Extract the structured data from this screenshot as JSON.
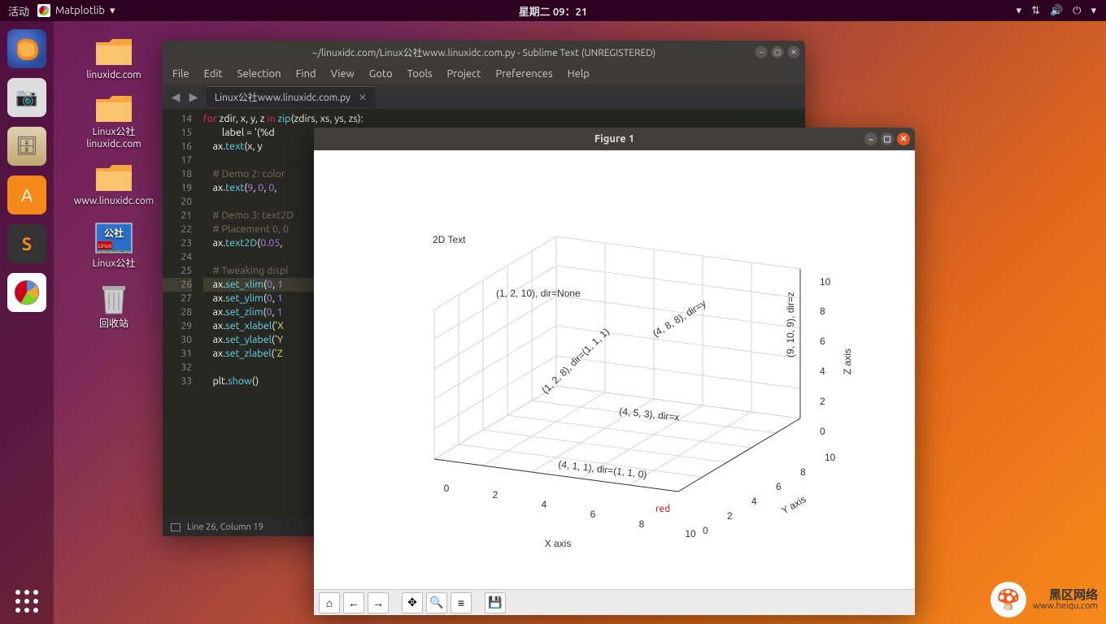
{
  "top_panel": {
    "activities": "活动",
    "app_label": "Matplotlib",
    "datetime": "星期二 09：21"
  },
  "desktop": {
    "icons": [
      {
        "label": "linuxidc.com"
      },
      {
        "label": "Linux公社linuxidc.com"
      },
      {
        "label": "www.linuxidc.com"
      },
      {
        "label": "Linux公社"
      },
      {
        "label": "回收站"
      }
    ]
  },
  "sublime": {
    "title": "~/linuxidc.com/Linux公社www.linuxidc.com.py - Sublime Text (UNREGISTERED)",
    "menu": [
      "File",
      "Edit",
      "Selection",
      "Find",
      "View",
      "Goto",
      "Tools",
      "Project",
      "Preferences",
      "Help"
    ],
    "tab": "Linux公社www.linuxidc.com.py",
    "status": "Line 26, Column 19",
    "lines": {
      "l14_for": "for",
      "l14_vars": " zdir, x, y, z ",
      "l14_in": "in",
      "l14_zip": " zip",
      "l14_args": "(zdirs, xs, ys, zs):",
      "l15": "        label = '(%d",
      "l16_a": "    ax.",
      "l16_b": "text",
      "l16_c": "(x, y",
      "l18": "    # Demo 2: color",
      "l19_a": "    ax.",
      "l19_b": "text",
      "l19_c": "(",
      "l19_9": "9",
      "l19_comma1": ", ",
      "l19_0a": "0",
      "l19_comma2": ", ",
      "l19_0b": "0",
      "l19_end": ",",
      "l21": "    # Demo 3: text2D",
      "l22": "    # Placement 0, 0",
      "l23_a": "    ax.",
      "l23_b": "text2D",
      "l23_c": "(",
      "l23_n": "0.05",
      "l23_end": ",",
      "l25": "    # Tweaking displ",
      "l26_a": "    ax.",
      "l26_b": "set_xlim",
      "l26_c": "(",
      "l26_0": "0",
      "l26_comma": ", ",
      "l26_1": "1",
      "l27_a": "    ax.",
      "l27_b": "set_ylim",
      "l27_c": "(",
      "l27_0": "0",
      "l27_comma": ", ",
      "l27_1": "1",
      "l28_a": "    ax.",
      "l28_b": "set_zlim",
      "l28_c": "(",
      "l28_0": "0",
      "l28_comma": ", ",
      "l28_1": "1",
      "l29_a": "    ax.",
      "l29_b": "set_xlabel",
      "l29_c": "(",
      "l29_s": "'X",
      "l30_a": "    ax.",
      "l30_b": "set_ylabel",
      "l30_c": "(",
      "l30_s": "'Y",
      "l31_a": "    ax.",
      "l31_b": "set_zlabel",
      "l31_c": "(",
      "l31_s": "'Z",
      "l33_a": "    plt.",
      "l33_b": "show",
      "l33_c": "()"
    }
  },
  "figure": {
    "title": "Figure 1",
    "text2d": "2D Text",
    "xlabel": "X axis",
    "ylabel": "Y axis",
    "zlabel": "Z axis",
    "red_label": "red",
    "annotations": {
      "none": "(1, 2, 10), dir=None",
      "xyz111": "(1, 2, 8), dir=(1, 1, 1)",
      "y": "(4, 8, 8), dir=y",
      "z": "(9, 10, 9), dir=z",
      "x": "(4, 5, 3), dir=x",
      "xyz110": "(4, 1, 1), dir=(1, 1, 0)"
    },
    "ticks": {
      "x": [
        "0",
        "2",
        "4",
        "6",
        "8",
        "10"
      ],
      "y": [
        "0",
        "2",
        "4",
        "6",
        "8",
        "10"
      ],
      "z": [
        "0",
        "2",
        "4",
        "6",
        "8",
        "10"
      ]
    }
  },
  "chart_data": {
    "type": "3d-text-demo",
    "xlim": [
      0,
      10
    ],
    "ylim": [
      0,
      10
    ],
    "zlim": [
      0,
      10
    ],
    "xlabel": "X axis",
    "ylabel": "Y axis",
    "zlabel": "Z axis",
    "text2d": {
      "x": 0.05,
      "label": "2D Text"
    },
    "red_point": {
      "x": 9,
      "y": 0,
      "z": 0,
      "label": "red",
      "color": "red"
    },
    "texts": [
      {
        "x": 1,
        "y": 2,
        "z": 10,
        "label": "(1, 2, 10), dir=None",
        "zdir": null
      },
      {
        "x": 1,
        "y": 2,
        "z": 8,
        "label": "(1, 2, 8), dir=(1, 1, 1)",
        "zdir": [
          1,
          1,
          1
        ]
      },
      {
        "x": 4,
        "y": 8,
        "z": 8,
        "label": "(4, 8, 8), dir=y",
        "zdir": "y"
      },
      {
        "x": 9,
        "y": 10,
        "z": 9,
        "label": "(9, 10, 9), dir=z",
        "zdir": "z"
      },
      {
        "x": 4,
        "y": 5,
        "z": 3,
        "label": "(4, 5, 3), dir=x",
        "zdir": "x"
      },
      {
        "x": 4,
        "y": 1,
        "z": 1,
        "label": "(4, 1, 1), dir=(1, 1, 0)",
        "zdir": [
          1,
          1,
          0
        ]
      }
    ]
  },
  "watermark": {
    "line1": "黑区网络",
    "line2": "www.heiqu.com"
  }
}
